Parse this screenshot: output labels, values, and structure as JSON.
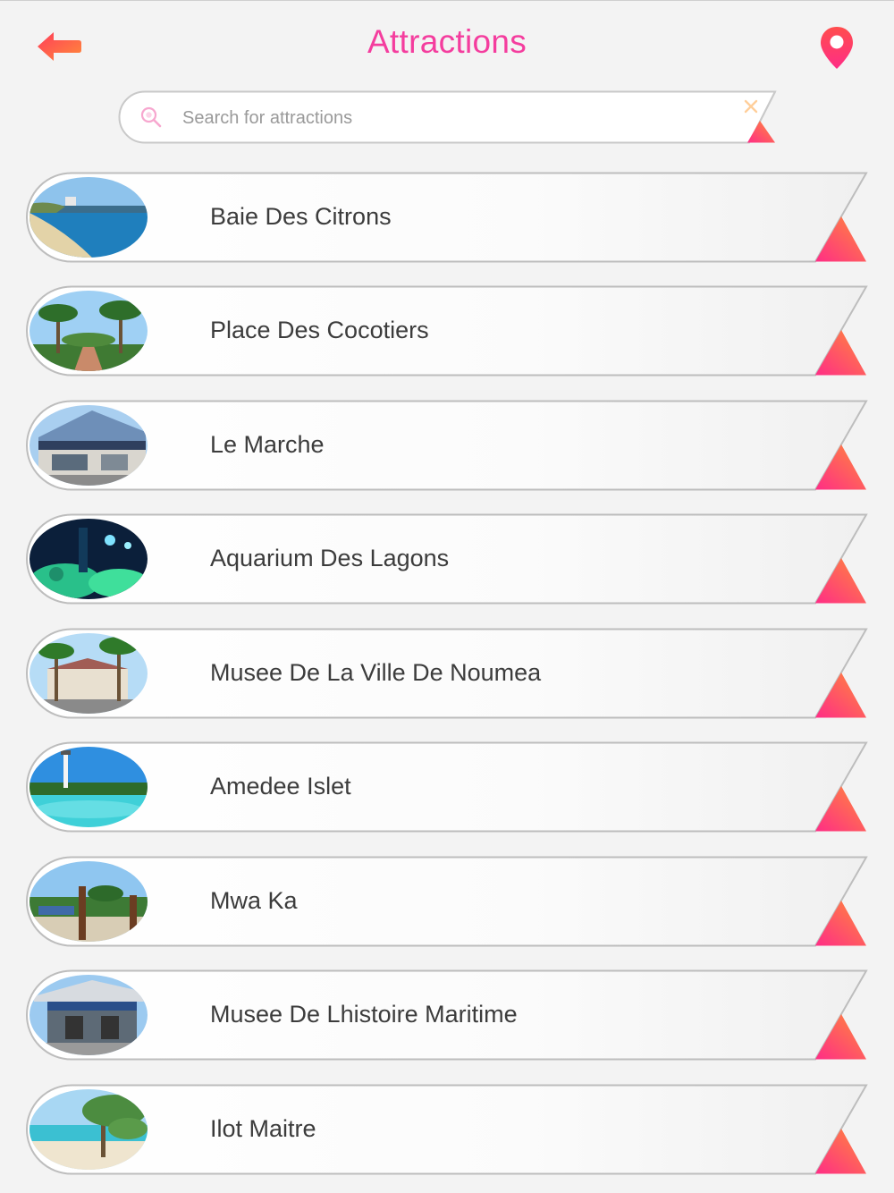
{
  "header": {
    "title": "Attractions",
    "back_icon": "back-arrow-icon",
    "map_icon": "map-pin-icon"
  },
  "search": {
    "placeholder": "Search for attractions",
    "value": "",
    "icon": "search-icon",
    "clear_icon": "close-icon"
  },
  "colors": {
    "title": "#f43d9e",
    "accent_start": "#ff2d86",
    "accent_end": "#ff8a3a",
    "text": "#3c3c3c"
  },
  "attractions": [
    {
      "name": "Baie Des Citrons",
      "thumbnail": "beach-bay"
    },
    {
      "name": "Place Des Cocotiers",
      "thumbnail": "palm-park"
    },
    {
      "name": "Le Marche",
      "thumbnail": "market-building"
    },
    {
      "name": "Aquarium Des Lagons",
      "thumbnail": "aquarium-coral"
    },
    {
      "name": "Musee De La Ville De Noumea",
      "thumbnail": "museum-palms"
    },
    {
      "name": "Amedee Islet",
      "thumbnail": "lighthouse-islet"
    },
    {
      "name": "Mwa Ka",
      "thumbnail": "totem-park"
    },
    {
      "name": "Musee De Lhistoire Maritime",
      "thumbnail": "maritime-museum"
    },
    {
      "name": "Ilot Maitre",
      "thumbnail": "islet-beach"
    }
  ]
}
